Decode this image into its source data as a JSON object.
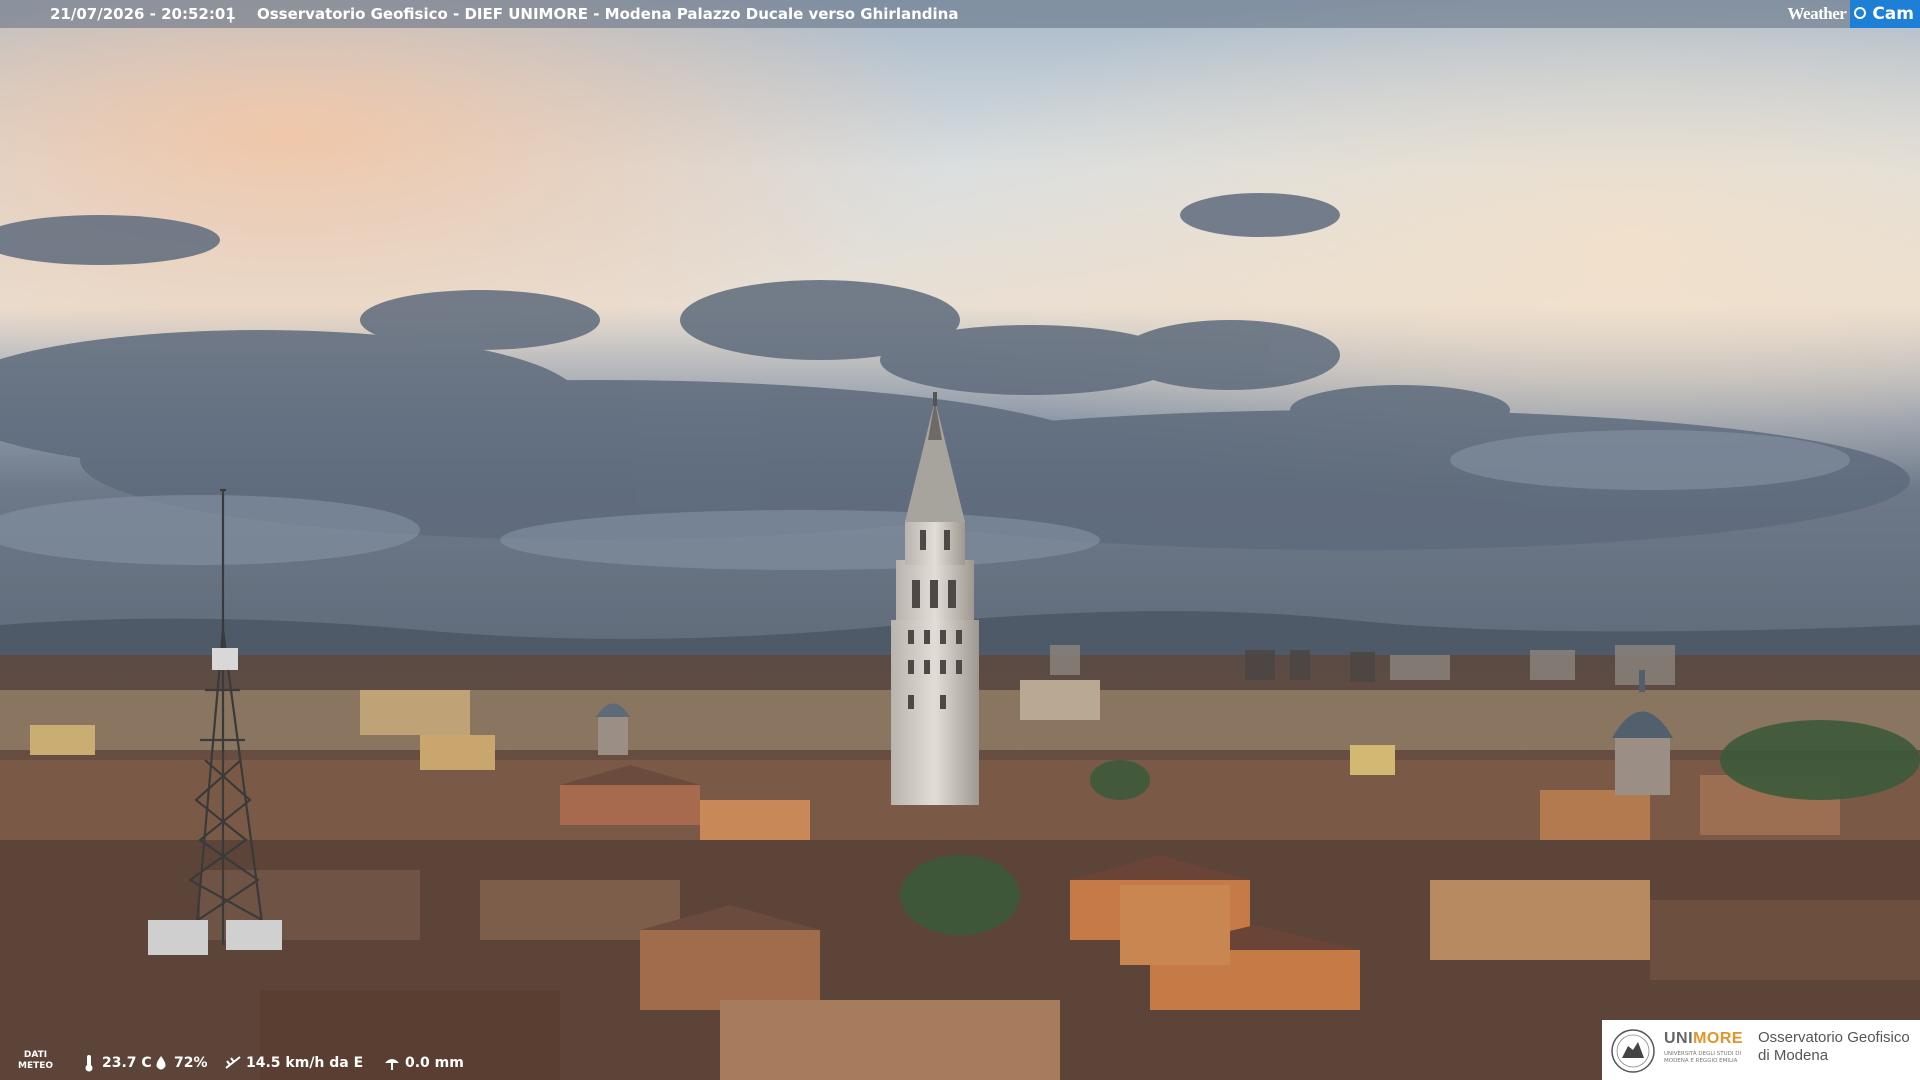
{
  "header": {
    "datetime": "21/07/2026 - 20:52:01",
    "separator": "|",
    "title": "Osservatorio Geofisico - DIEF UNIMORE - Modena Palazzo Ducale verso Ghirlandina"
  },
  "brand": {
    "weather_text": "Weather",
    "cam_text": "Cam"
  },
  "meteo": {
    "label_line1": "DATI",
    "label_line2": "METEO",
    "temperature": "23.7 C",
    "humidity": "72%",
    "wind": "14.5 km/h da E",
    "rain": "0.0 mm"
  },
  "footer_logo": {
    "uni_prefix": "UNI",
    "uni_suffix": "MORE",
    "uni_subtitle": "UNIVERSITÀ DEGLI STUDI DI MODENA E REGGIO EMILIA",
    "observatory_line1": "Osservatorio Geofisico",
    "observatory_line2": "di Modena"
  },
  "colors": {
    "cam_blue": "#1d7fd6",
    "uni_orange": "#e39424"
  },
  "icons": [
    "thermometer-icon",
    "humidity-drop-icon",
    "wind-icon",
    "rain-gauge-icon",
    "university-seal-icon"
  ]
}
